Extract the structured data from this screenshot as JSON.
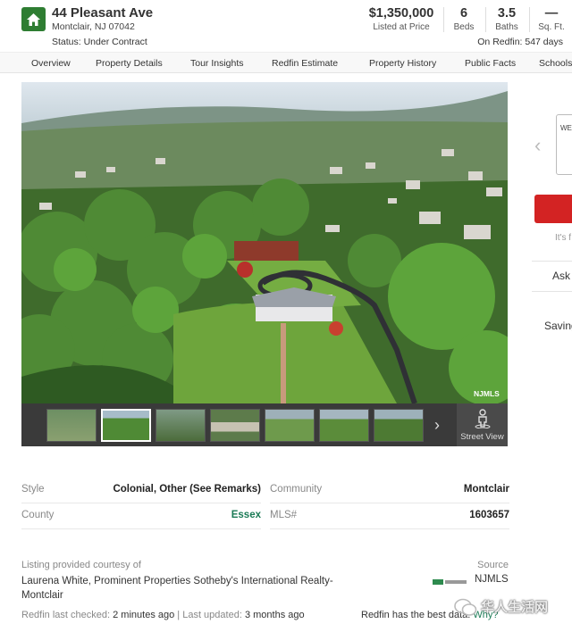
{
  "header": {
    "address": "44 Pleasant Ave",
    "city_state_zip": "Montclair, NJ 07042",
    "status": "Status: Under Contract",
    "price": "$1,350,000",
    "price_label": "Listed at Price",
    "beds": "6",
    "beds_label": "Beds",
    "baths": "3.5",
    "baths_label": "Baths",
    "sqft": "—",
    "sqft_label": "Sq. Ft.",
    "on_redfin": "On Redfin: 547 days"
  },
  "nav": [
    "Overview",
    "Property Details",
    "Tour Insights",
    "Redfin Estimate",
    "Property History",
    "Public Facts",
    "Schools"
  ],
  "photo": {
    "watermark": "NJMLS",
    "street_view_label": "Street View",
    "next_arrow": "›"
  },
  "side_panel": {
    "box_text": "WE",
    "its_text": "It's f",
    "ask_text": "Ask",
    "saving_text": "Saving"
  },
  "details": {
    "style_label": "Style",
    "style_value": "Colonial, Other (See Remarks)",
    "county_label": "County",
    "county_value": "Essex",
    "community_label": "Community",
    "community_value": "Montclair",
    "mls_label": "MLS#",
    "mls_value": "1603657"
  },
  "footer": {
    "courtesy_label": "Listing provided courtesy of",
    "courtesy_text": "Laurena White, Prominent Properties Sotheby's International Realty-Montclair",
    "source_label": "Source",
    "source_value": "NJMLS",
    "last_checked_label": "Redfin last checked:",
    "last_checked_value": "2 minutes ago",
    "last_updated_label": "| Last updated:",
    "last_updated_value": "3 months ago",
    "best_data_text": "Redfin has the best data.",
    "why_link": "Why?",
    "wechat_label": "华人生活网"
  },
  "colors": {
    "brand_green": "#2e7d32",
    "redfin_red": "#d32323",
    "link_green": "#1a7a55"
  }
}
